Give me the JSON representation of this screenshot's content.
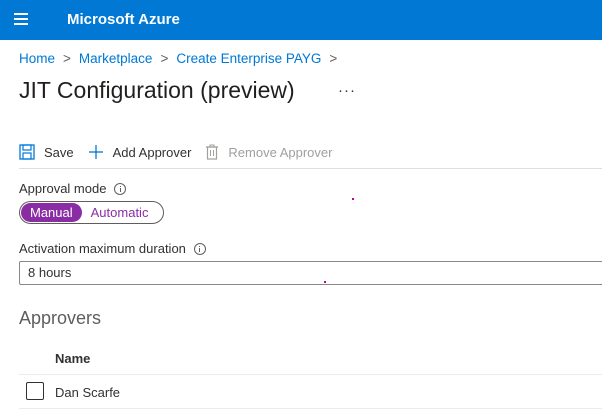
{
  "header": {
    "brand": "Microsoft Azure",
    "menu_icon": "hamburger-icon",
    "color": "#0078d4"
  },
  "breadcrumb": {
    "items": [
      "Home",
      "Marketplace",
      "Create Enterprise PAYG"
    ],
    "separator": ">"
  },
  "page": {
    "title": "JIT Configuration (preview)",
    "more": "···"
  },
  "toolbar": {
    "save_label": "Save",
    "add_approver_label": "Add Approver",
    "remove_approver_label": "Remove Approver"
  },
  "approval_mode": {
    "label": "Approval mode",
    "options": [
      "Manual",
      "Automatic"
    ],
    "selected": "Manual",
    "accent": "#8a2da5"
  },
  "activation": {
    "label": "Activation maximum duration",
    "value": "8 hours"
  },
  "approvers": {
    "section_title": "Approvers",
    "column": "Name",
    "rows": [
      {
        "name": "Dan Scarfe",
        "checked": false
      }
    ]
  }
}
